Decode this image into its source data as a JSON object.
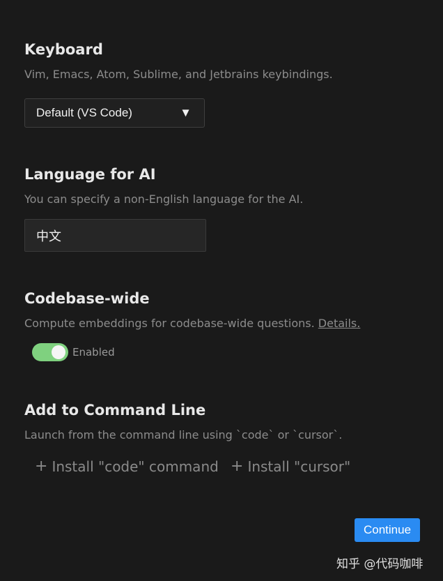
{
  "keyboard": {
    "title": "Keyboard",
    "description": "Vim, Emacs, Atom, Sublime, and Jetbrains keybindings.",
    "selected": "Default (VS Code)"
  },
  "language": {
    "title": "Language for AI",
    "description": "You can specify a non-English language for the AI.",
    "value": "中文"
  },
  "codebase": {
    "title": "Codebase-wide",
    "description": "Compute embeddings for codebase-wide questions.",
    "details_link": "Details.",
    "toggle_label": "Enabled",
    "toggle_on": true,
    "toggle_color": "#7fd17f"
  },
  "command_line": {
    "title": "Add to Command Line",
    "description": "Launch from the command line using `code` or `cursor`.",
    "install_code": "Install \"code\" command",
    "install_cursor": "Install \"cursor\""
  },
  "footer": {
    "continue_label": "Continue",
    "accent": "#2a8bf2"
  },
  "watermark": "知乎 @代码咖啡",
  "icons": {
    "dropdown": "chevron-down-icon",
    "plus": "plus-icon"
  }
}
